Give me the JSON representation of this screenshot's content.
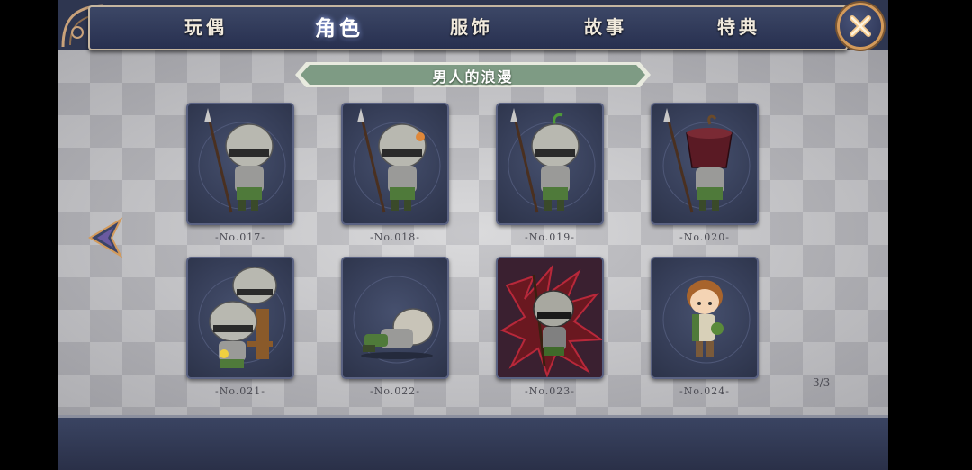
{
  "tabs": [
    {
      "label": "玩偶",
      "active": false
    },
    {
      "label": "角色",
      "active": true
    },
    {
      "label": "服饰",
      "active": false
    },
    {
      "label": "故事",
      "active": false
    },
    {
      "label": "特典",
      "active": false
    }
  ],
  "close_icon": "close-x-icon",
  "section_title": "男人的浪漫",
  "cards": [
    {
      "label": "-No.017-",
      "character": "helmeted-spear-soldier"
    },
    {
      "label": "-No.018-",
      "character": "helmeted-spear-soldier-orange-plume"
    },
    {
      "label": "-No.019-",
      "character": "helmeted-spear-soldier-green-sprout"
    },
    {
      "label": "-No.020-",
      "character": "spear-soldier-pot-helmet"
    },
    {
      "label": "-No.021-",
      "character": "two-soldiers-on-chair"
    },
    {
      "label": "-No.022-",
      "character": "fallen-soldier"
    },
    {
      "label": "-No.023-",
      "character": "soldier-red-dark-aura"
    },
    {
      "label": "-No.024-",
      "character": "brown-haired-boy"
    }
  ],
  "nav": {
    "back_icon": "back-arrow-icon"
  },
  "page_indicator": "3/3",
  "colors": {
    "accent_border": "#d39a5a",
    "frame": "#2e3650",
    "ribbon": "#7e9b84"
  }
}
